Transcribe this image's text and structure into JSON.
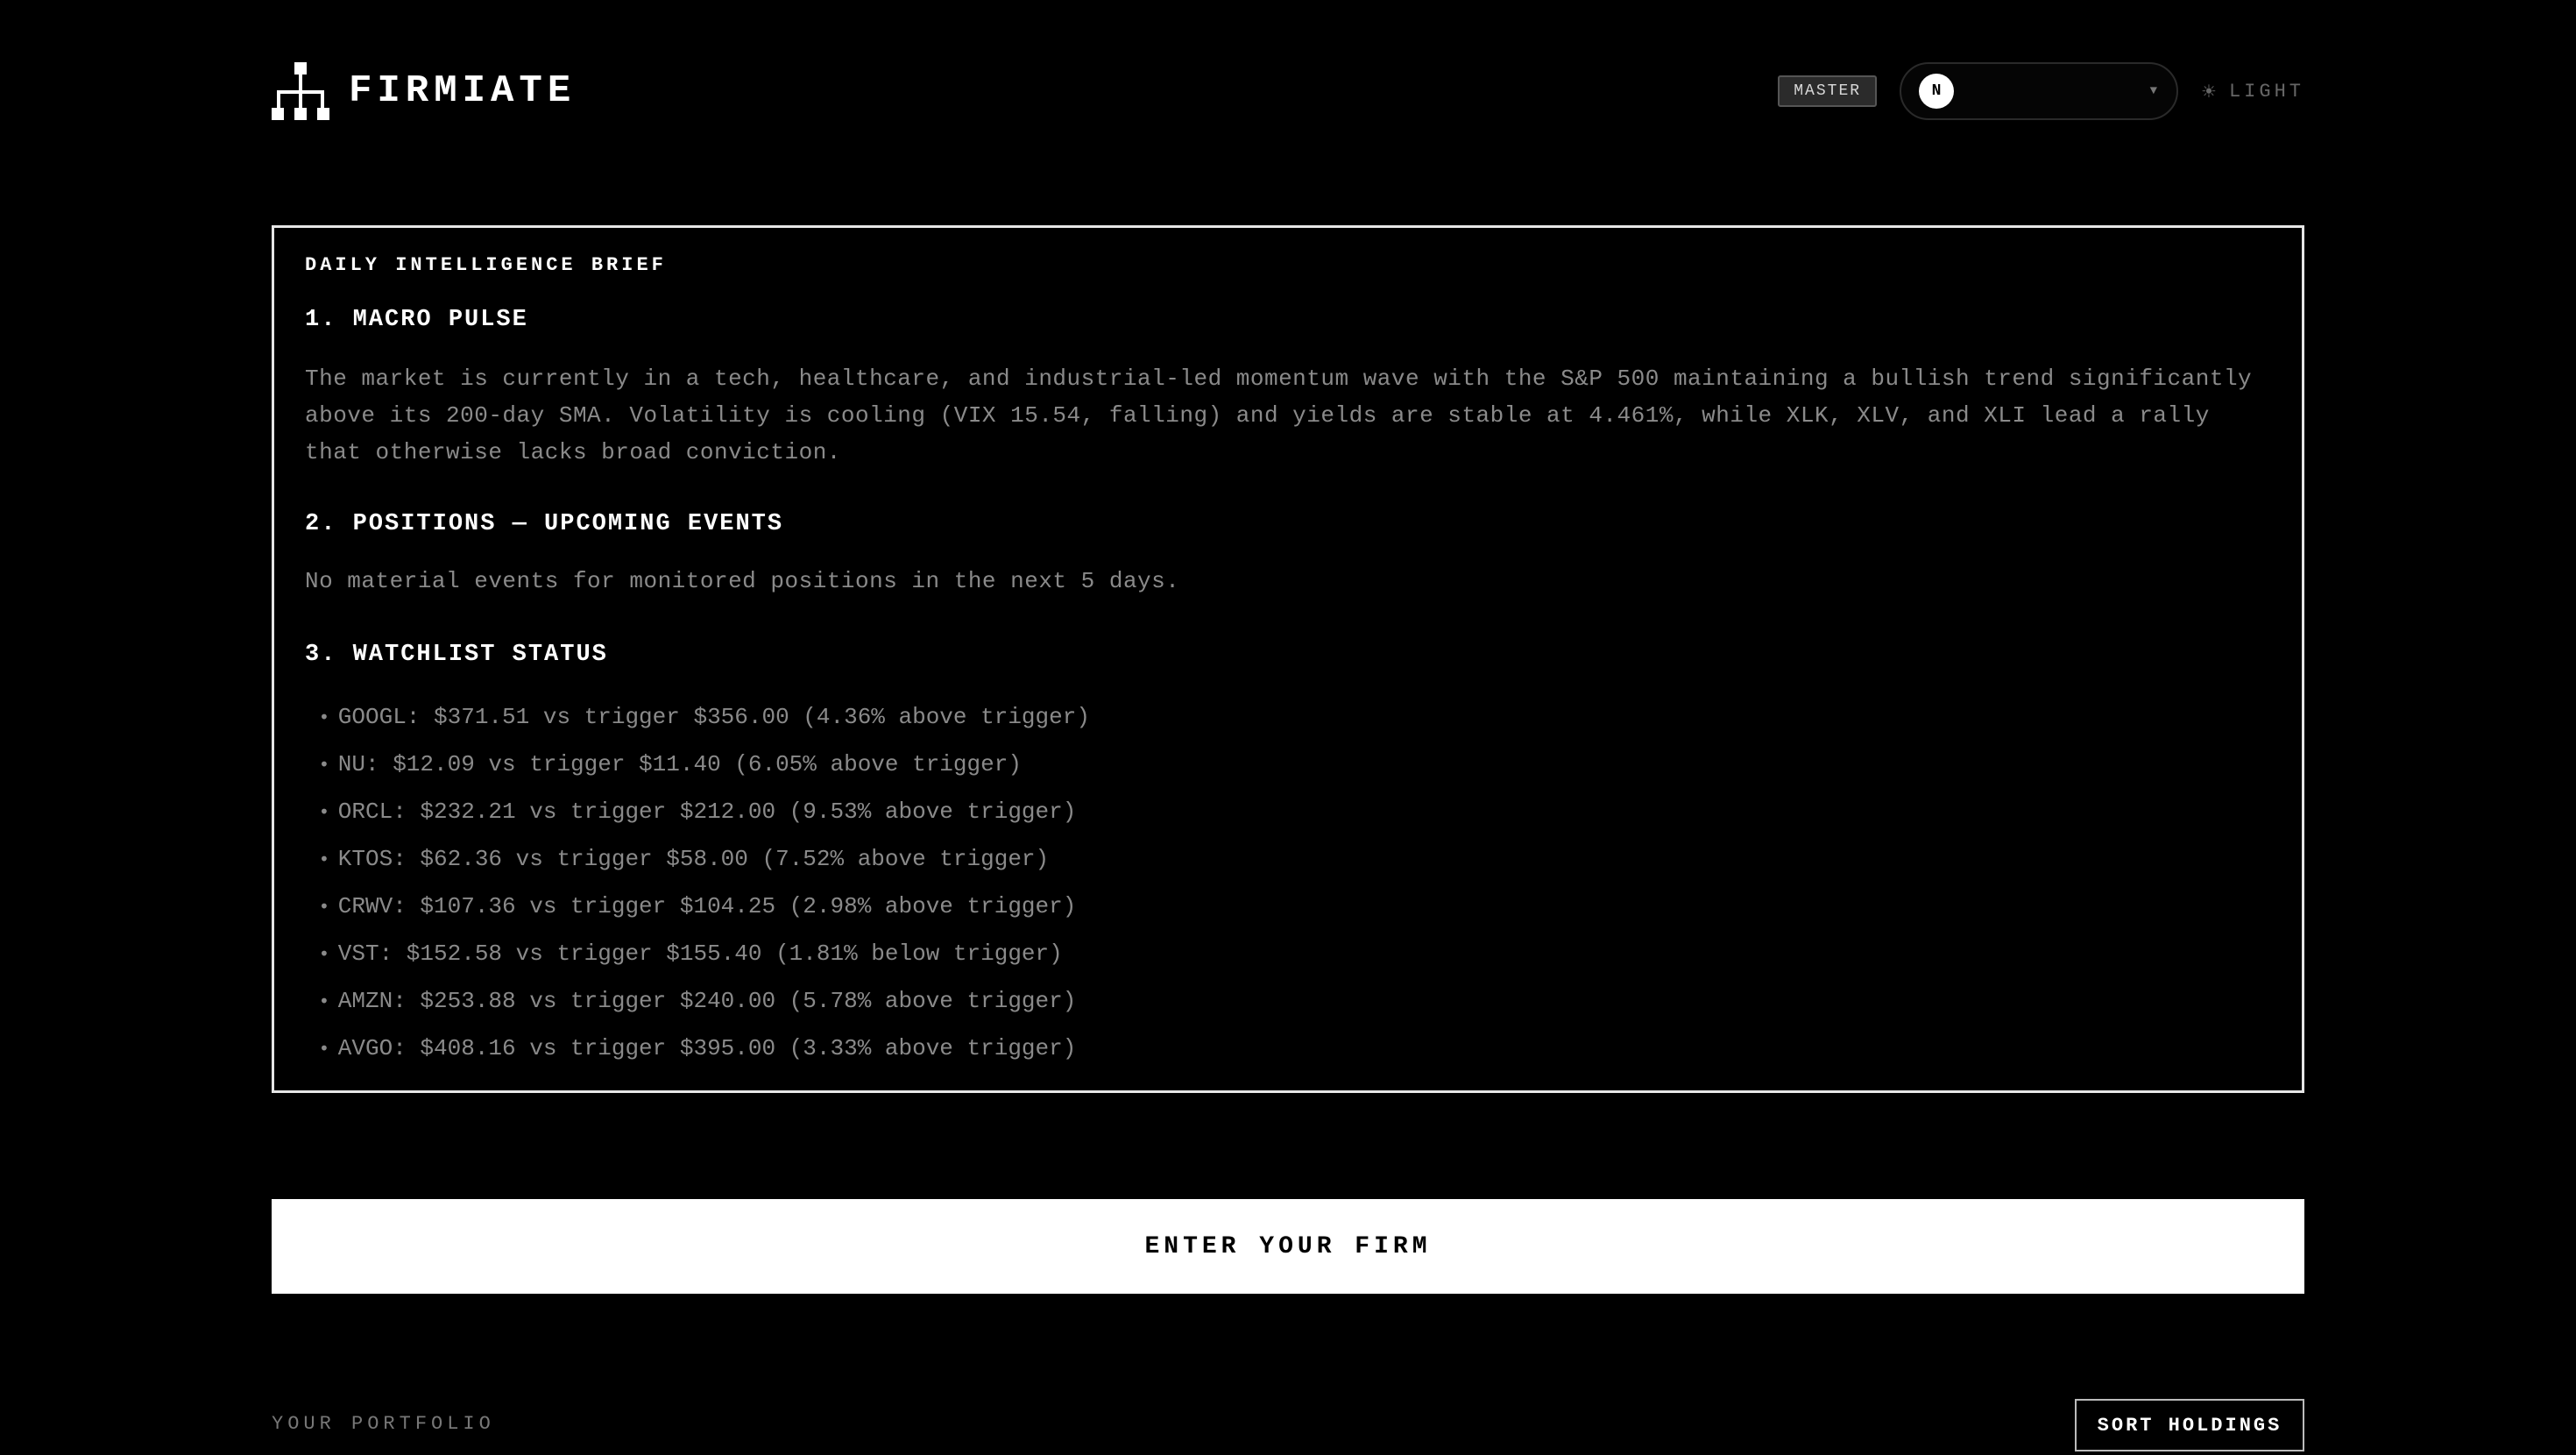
{
  "header": {
    "brand_name": "FIRMIATE",
    "logo_icon": "org-chart-icon",
    "badge": "MASTER",
    "user_initial": "N",
    "theme_toggle_label": "LIGHT",
    "theme_icon": "sun-icon"
  },
  "brief": {
    "title": "DAILY INTELLIGENCE BRIEF",
    "sections": [
      {
        "heading": "1. MACRO PULSE",
        "text": "The market is currently in a tech, healthcare, and industrial-led momentum wave with the S&P 500 maintaining a bullish trend significantly above its 200-day SMA. Volatility is cooling (VIX 15.54, falling) and yields are stable at 4.461%, while XLK, XLV, and XLI lead a rally that otherwise lacks broad conviction."
      },
      {
        "heading": "2. POSITIONS — UPCOMING EVENTS",
        "text": "No material events for monitored positions in the next 5 days."
      },
      {
        "heading": "3. WATCHLIST STATUS",
        "items": [
          "GOOGL: $371.51 vs trigger $356.00 (4.36% above trigger)",
          "NU: $12.09 vs trigger $11.40 (6.05% above trigger)",
          "ORCL: $232.21 vs trigger $212.00 (9.53% above trigger)",
          "KTOS: $62.36 vs trigger $58.00 (7.52% above trigger)",
          "CRWV: $107.36 vs trigger $104.25 (2.98% above trigger)",
          "VST: $152.58 vs trigger $155.40 (1.81% below trigger)",
          "AMZN: $253.88 vs trigger $240.00 (5.78% above trigger)",
          "AVGO: $408.16 vs trigger $395.00 (3.33% above trigger)"
        ]
      }
    ]
  },
  "actions": {
    "enter_label": "ENTER YOUR FIRM",
    "portfolio_label": "YOUR PORTFOLIO",
    "sort_label": "SORT HOLDINGS"
  },
  "colors": {
    "background": "#000000",
    "foreground": "#ffffff",
    "muted_text": "#8a8a8a"
  }
}
